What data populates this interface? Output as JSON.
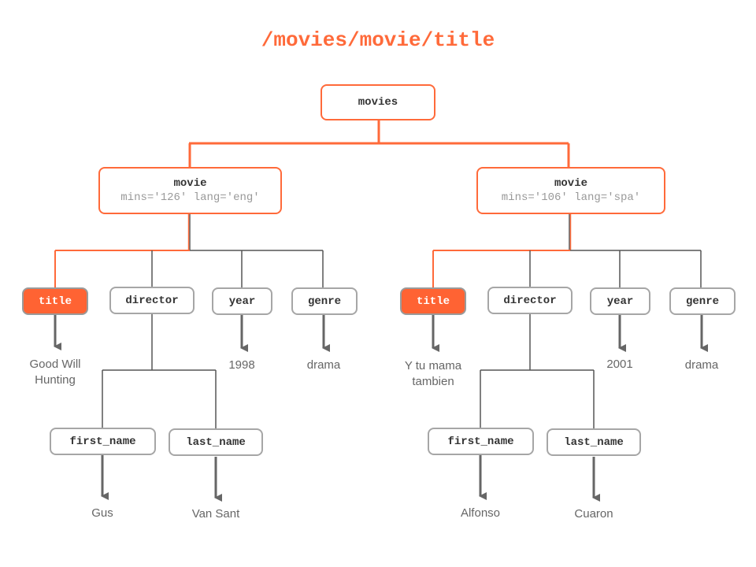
{
  "diagram": {
    "xpath": "/movies/movie/title",
    "colors": {
      "highlight": "#ff6a3a",
      "selected_fill": "#ff6333",
      "neutral_line": "#555555",
      "node_border": "#a6a6a6",
      "value_text": "#666666"
    },
    "root": {
      "name": "movies"
    },
    "movies": [
      {
        "name": "movie",
        "attrs": "mins='126' lang='eng'",
        "children": {
          "title": {
            "name": "title",
            "value": "Good Will\nHunting",
            "selected": true
          },
          "director": {
            "name": "director"
          },
          "year": {
            "name": "year",
            "value": "1998"
          },
          "genre": {
            "name": "genre",
            "value": "drama"
          }
        },
        "director_children": {
          "first_name": {
            "name": "first_name",
            "value": "Gus"
          },
          "last_name": {
            "name": "last_name",
            "value": "Van Sant"
          }
        }
      },
      {
        "name": "movie",
        "attrs": "mins='106' lang='spa'",
        "children": {
          "title": {
            "name": "title",
            "value": "Y tu mama\ntambien",
            "selected": true
          },
          "director": {
            "name": "director"
          },
          "year": {
            "name": "year",
            "value": "2001"
          },
          "genre": {
            "name": "genre",
            "value": "drama"
          }
        },
        "director_children": {
          "first_name": {
            "name": "first_name",
            "value": "Alfonso"
          },
          "last_name": {
            "name": "last_name",
            "value": "Cuaron"
          }
        }
      }
    ]
  }
}
